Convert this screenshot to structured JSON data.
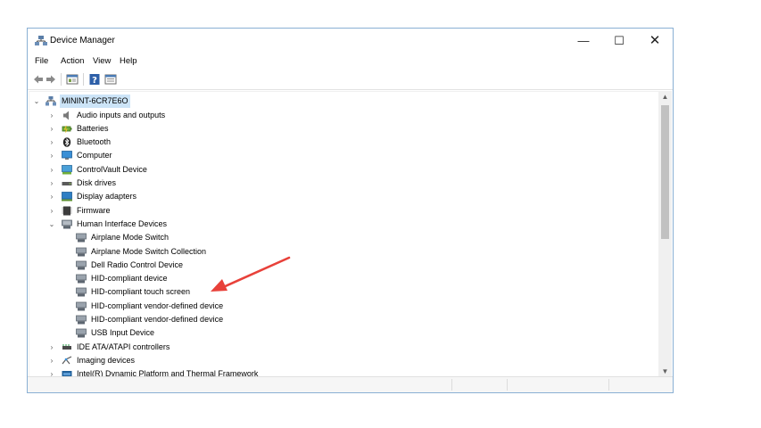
{
  "window": {
    "title": "Device Manager",
    "controls": {
      "minimize": "—",
      "maximize": "☐",
      "close": "✕"
    }
  },
  "menubar": [
    "File",
    "Action",
    "View",
    "Help"
  ],
  "tree": {
    "root": "MININT-6CR7E6O",
    "categories": [
      {
        "label": "Audio inputs and outputs",
        "icon": "speaker-icon"
      },
      {
        "label": "Batteries",
        "icon": "battery-icon"
      },
      {
        "label": "Bluetooth",
        "icon": "bluetooth-icon"
      },
      {
        "label": "Computer",
        "icon": "computer-icon"
      },
      {
        "label": "ControlVault Device",
        "icon": "controlvault-icon"
      },
      {
        "label": "Disk drives",
        "icon": "disk-drive-icon"
      },
      {
        "label": "Display adapters",
        "icon": "display-adapter-icon"
      },
      {
        "label": "Firmware",
        "icon": "firmware-icon"
      },
      {
        "label": "Human Interface Devices",
        "icon": "hid-icon",
        "expanded": true,
        "children": [
          "Airplane Mode Switch",
          "Airplane Mode Switch Collection",
          "Dell Radio Control Device",
          "HID-compliant device",
          "HID-compliant touch screen",
          "HID-compliant vendor-defined device",
          "HID-compliant vendor-defined device",
          "USB Input Device"
        ]
      },
      {
        "label": "IDE ATA/ATAPI controllers",
        "icon": "ide-controller-icon"
      },
      {
        "label": "Imaging devices",
        "icon": "imaging-icon"
      },
      {
        "label": "Intel(R) Dynamic Platform and Thermal Framework",
        "icon": "intel-dptf-icon"
      }
    ]
  },
  "colors": {
    "selection": "#cce4f7",
    "window_border": "#8ab0d4",
    "annotation_arrow": "#e8413a"
  }
}
